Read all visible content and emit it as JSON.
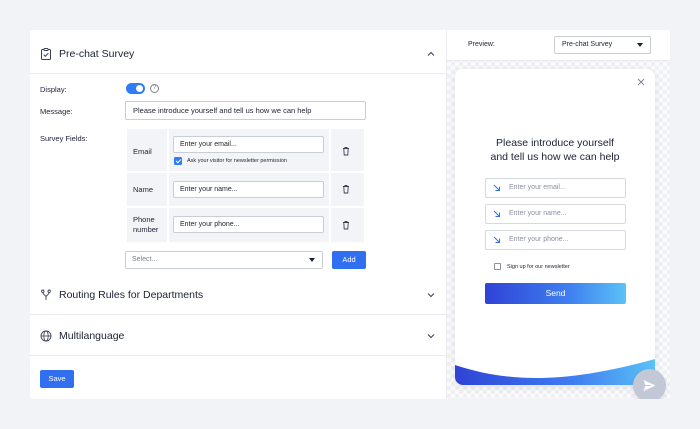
{
  "sections": {
    "prechat_title": "Pre-chat Survey",
    "routing_title": "Routing Rules for Departments",
    "multilanguage_title": "Multilanguage"
  },
  "form": {
    "display_label": "Display:",
    "display_enabled": true,
    "message_label": "Message:",
    "message_value": "Please introduce yourself and tell us how we can help",
    "survey_fields_label": "Survey Fields:",
    "fields": [
      {
        "name": "Email",
        "placeholder": "Enter your email...",
        "newsletter_label": "Ask your visitor for newsletter permission",
        "newsletter_checked": true
      },
      {
        "name": "Name",
        "placeholder": "Enter your name..."
      },
      {
        "name_line1": "Phone",
        "name_line2": "number",
        "placeholder": "Enter your phone..."
      }
    ],
    "select_placeholder": "Select...",
    "add_label": "Add",
    "save_label": "Save"
  },
  "preview": {
    "label": "Preview:",
    "selected": "Pre-chat Survey",
    "heading_line1": "Please introduce yourself",
    "heading_line2": "and tell us how we can help",
    "email_placeholder": "Enter your email...",
    "name_placeholder": "Enter your name...",
    "phone_placeholder": "Enter your phone...",
    "newsletter_label": "Sign up for our newsletter",
    "send_label": "Send"
  },
  "icons": {
    "prechat": "clipboard-check-icon",
    "routing": "fork-icon",
    "multilanguage": "globe-icon",
    "chevron_up": "chevron-up-icon",
    "chevron_down": "chevron-down-icon",
    "help": "help-icon",
    "trash": "trash-icon",
    "close": "close-icon",
    "field_arrow": "arrow-down-right-icon",
    "fab": "send-icon"
  },
  "colors": {
    "accent": "#2f6ff0",
    "toggle_on": "#2f7df6",
    "send_gradient_start": "#2f43d6",
    "send_gradient_end": "#5bc2f6"
  }
}
